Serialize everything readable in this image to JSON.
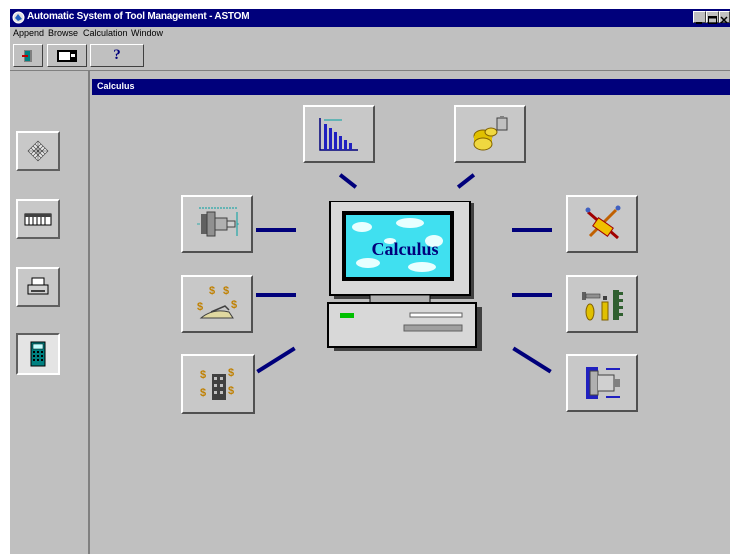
{
  "window": {
    "title": "Automatic System of Tool Management - ASTOM",
    "caption_buttons": [
      "minimize",
      "maximize",
      "close"
    ]
  },
  "menu": {
    "items": [
      "Append",
      "Browse",
      "Calculation",
      "Window"
    ]
  },
  "toolbar": {
    "buttons": [
      {
        "icon": "exit-door-icon"
      },
      {
        "icon": "screen-view-icon"
      },
      {
        "icon": "help-question-icon",
        "label": "?"
      }
    ]
  },
  "sidebar": {
    "buttons": [
      {
        "icon": "grid-pattern-icon"
      },
      {
        "icon": "table-list-icon"
      },
      {
        "icon": "printer-icon"
      },
      {
        "icon": "calculator-icon",
        "pressed": true
      }
    ]
  },
  "child_window": {
    "title": "Calculus",
    "screen_label": "Calculus"
  },
  "calc_buttons": [
    {
      "icon": "bar-chart-icon"
    },
    {
      "icon": "cylinders-weight-icon"
    },
    {
      "icon": "shaft-drawing-icon"
    },
    {
      "icon": "dollar-hand-icon"
    },
    {
      "icon": "dollar-building-icon"
    },
    {
      "icon": "cutting-tool-icon"
    },
    {
      "icon": "tool-gear-icon"
    },
    {
      "icon": "spindle-holder-icon"
    }
  ],
  "colors": {
    "titlebar": "#00007b",
    "face": "#c0c0c0",
    "connector": "#00007b",
    "screen_cyan": "#40e0f0"
  }
}
